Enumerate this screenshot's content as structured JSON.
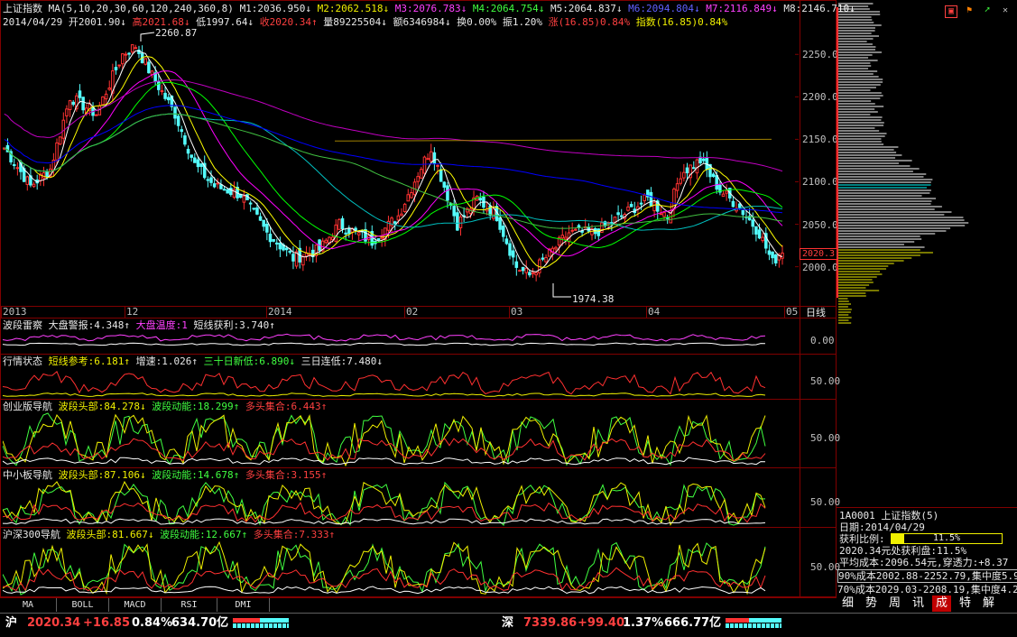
{
  "colors": {
    "up": "#ff3232",
    "down": "#54fcfc",
    "frame": "#800000",
    "ma5": "#ffffff",
    "ma10": "#ffff00",
    "ma20": "#ff00ff",
    "ma30": "#00ff00",
    "ma60": "#ff80ff",
    "ma120": "#00c000",
    "ma240": "#0000ff",
    "ma360": "#c000c0"
  },
  "header": {
    "title": "上证指数",
    "ma_params": "MA(5,10,20,30,60,120,240,360,8)",
    "m1": "M1:2036.950↓",
    "m2": "M2:2062.518↓",
    "m3": "M3:2076.783↓",
    "m4": "M4:2064.754↓",
    "m5": "M5:2064.837↓",
    "m6": "M6:2094.804↓",
    "m7": "M7:2116.849↓",
    "m8": "M8:2146.710↓",
    "date": "2014/04/29",
    "open": "开2001.90↓",
    "high": "高2021.68↓",
    "low": "低1997.64↓",
    "close": "收2020.34↑",
    "vol": "量89225504↓",
    "amount": "额6346984↓",
    "turnover": "换0.00%",
    "amplitude": "振1.20%",
    "change": "涨(16.85)0.84%",
    "index_change": "指数(16.85)0.84%"
  },
  "main_chart": {
    "y_labels": [
      "2250.0",
      "2200.0",
      "2150.0",
      "2100.0",
      "2050.0",
      "2000.0"
    ],
    "y_values": [
      2250,
      2200,
      2150,
      2100,
      2050,
      2000
    ],
    "price_tag": "2020.3",
    "max_label": "2260.87",
    "min_label": "1974.38",
    "x_labels": [
      "2013",
      "12",
      "2014",
      "02",
      "03",
      "04",
      "05"
    ],
    "period_label": "日线"
  },
  "indicators": [
    {
      "name": "波段雷察",
      "items": [
        {
          "t": "大盘警报:4.348↑",
          "c": "#e8e8e8"
        },
        {
          "t": "大盘温度:1",
          "c": "#ff40ff"
        },
        {
          "t": "短线获利:3.740↑",
          "c": "#e8e8e8"
        }
      ],
      "level": "0.00"
    },
    {
      "name": "行情状态",
      "items": [
        {
          "t": "短线参考:6.181↑",
          "c": "#f0f000"
        },
        {
          "t": "增速:1.026↑",
          "c": "#e8e8e8"
        },
        {
          "t": "三十日新低:6.890↓",
          "c": "#40ff40"
        },
        {
          "t": "三日连低:7.480↓",
          "c": "#e8e8e8"
        }
      ],
      "level": "50.00"
    },
    {
      "name": "创业版导航",
      "items": [
        {
          "t": "波段头部:84.278↓",
          "c": "#f0f000"
        },
        {
          "t": "波段动能:18.299↑",
          "c": "#40ff40"
        },
        {
          "t": "多头集合:6.443↑",
          "c": "#ff4040"
        }
      ],
      "level": "50.00"
    },
    {
      "name": "中小板导航",
      "items": [
        {
          "t": "波段头部:87.106↓",
          "c": "#f0f000"
        },
        {
          "t": "波段动能:14.678↑",
          "c": "#40ff40"
        },
        {
          "t": "多头集合:3.155↑",
          "c": "#ff4040"
        }
      ],
      "level": "50.00"
    },
    {
      "name": "沪深300导航",
      "items": [
        {
          "t": "波段头部:81.667↓",
          "c": "#f0f000"
        },
        {
          "t": "波段动能:12.667↑",
          "c": "#40ff40"
        },
        {
          "t": "多头集合:7.333↑",
          "c": "#ff4040"
        }
      ],
      "level": "50.00"
    }
  ],
  "bottom_tabs": [
    "MA",
    "BOLL",
    "MACD",
    "RSI",
    "DMI"
  ],
  "right_panel": {
    "code": "1A0001",
    "name": "上证指数",
    "cyc": "(5)",
    "date": "日期:2014/04/29",
    "profit_ratio_label": "获利比例:",
    "profit_ratio": "11.5%",
    "profit_ratio_value": 0.115,
    "line1": "2020.34元处获利盘:11.5%",
    "line2": "平均成本:2096.54元,穿透力:+8.37",
    "line3": "90%成本2002.88-2252.79,集中度5.9",
    "line4": "70%成本2029.03-2208.19,集中度4.2",
    "tabs": [
      "细",
      "势",
      "周",
      "讯",
      "成",
      "特",
      "解"
    ]
  },
  "status_bar": {
    "sh_label": "沪",
    "sh_index": "2020.34",
    "sh_change": "+16.85",
    "sh_pct": "0.84%",
    "sh_amount": "634.70亿",
    "sz_label": "深",
    "sz_index": "7339.86",
    "sz_change": "+99.40",
    "sz_pct": "1.37%",
    "sz_amount": "666.77亿"
  },
  "icons": [
    "square-icon",
    "flag-icon",
    "arrow-icon",
    "tools-icon"
  ]
}
